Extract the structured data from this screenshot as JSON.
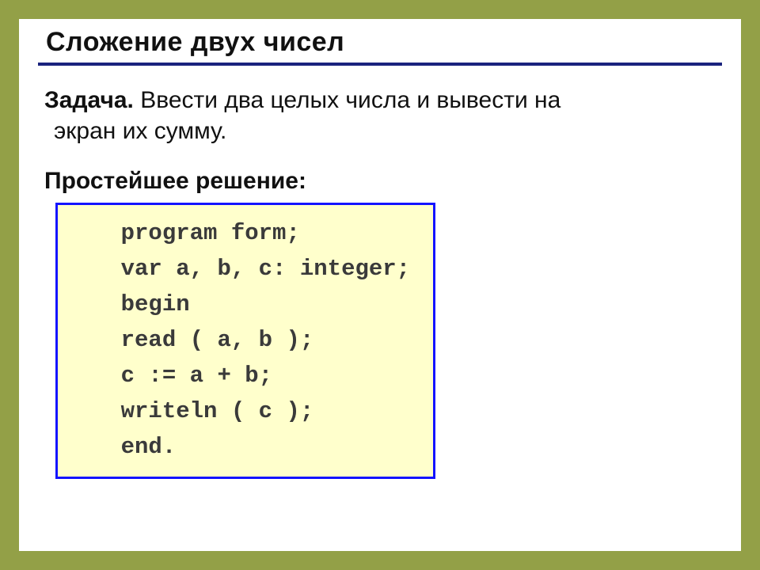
{
  "title": "Сложение двух чисел",
  "task": {
    "label": "Задача.",
    "text_part1": " Ввести два целых числа и вывести на",
    "text_part2": "экран их сумму."
  },
  "solution_label": "Простейшее решение:",
  "code": "    program form;\n    var a, b, c: integer;\n    begin\n    read ( a, b );\n    c := a + b;\n    writeln ( c );\n    end."
}
